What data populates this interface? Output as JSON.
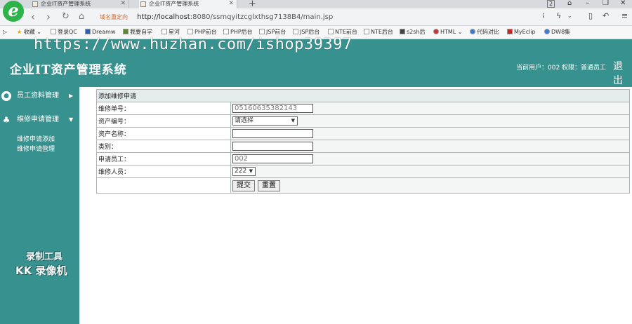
{
  "browser": {
    "tabs": [
      {
        "label": "企业IT资产管理系统",
        "active": false
      },
      {
        "label": "企业IT资产管理系统",
        "active": true
      }
    ],
    "url_warning": "域名重定向",
    "url_host": "http://localhost",
    "url_path": ":8080/ssmqyitzcglxthsg7138B4/main.jsp",
    "tab_count": "2",
    "bookmarks": [
      "收藏",
      "登录QC",
      "Dreamw",
      "我要自学",
      "星河",
      "PHP前台",
      "PHP后台",
      "JSP前台",
      "JSP后台",
      "NTE前台",
      "NTE后台",
      "s2sh后",
      "HTML",
      "代码对比",
      "MyEclip",
      "DW8集"
    ]
  },
  "watermark": "https://www.huzhan.com/ishop39397",
  "app": {
    "title": "企业IT资产管理系统",
    "user_info": "当前用户：002 权限：普通员工",
    "logout": "退出"
  },
  "sidebar": {
    "menus": [
      {
        "label": "员工资料管理",
        "arrow": "▶",
        "icon": "person-icon"
      },
      {
        "label": "维修申请管理",
        "arrow": "▼",
        "icon": "repair-icon"
      }
    ],
    "submenu": [
      "维修申请添加",
      "维修申请管理"
    ],
    "recorder_line1": "录制工具",
    "recorder_line2": "KK 录像机"
  },
  "form": {
    "caption": "添加维修申请",
    "fields": [
      {
        "label": "维修单号：",
        "value": "05160635382143",
        "type": "text"
      },
      {
        "label": "资产编号：",
        "value": "请选择",
        "type": "select"
      },
      {
        "label": "资产名称：",
        "value": "",
        "type": "text"
      },
      {
        "label": "类别：",
        "value": "",
        "type": "text"
      },
      {
        "label": "申请员工：",
        "value": "002",
        "type": "text"
      },
      {
        "label": "维修人员：",
        "value": "222",
        "type": "select"
      }
    ],
    "submit_label": "提交",
    "reset_label": "重置"
  },
  "colors": {
    "accent": "#36918f",
    "tab_bg": "#d7dadf",
    "url_warning": "#e0651a"
  }
}
